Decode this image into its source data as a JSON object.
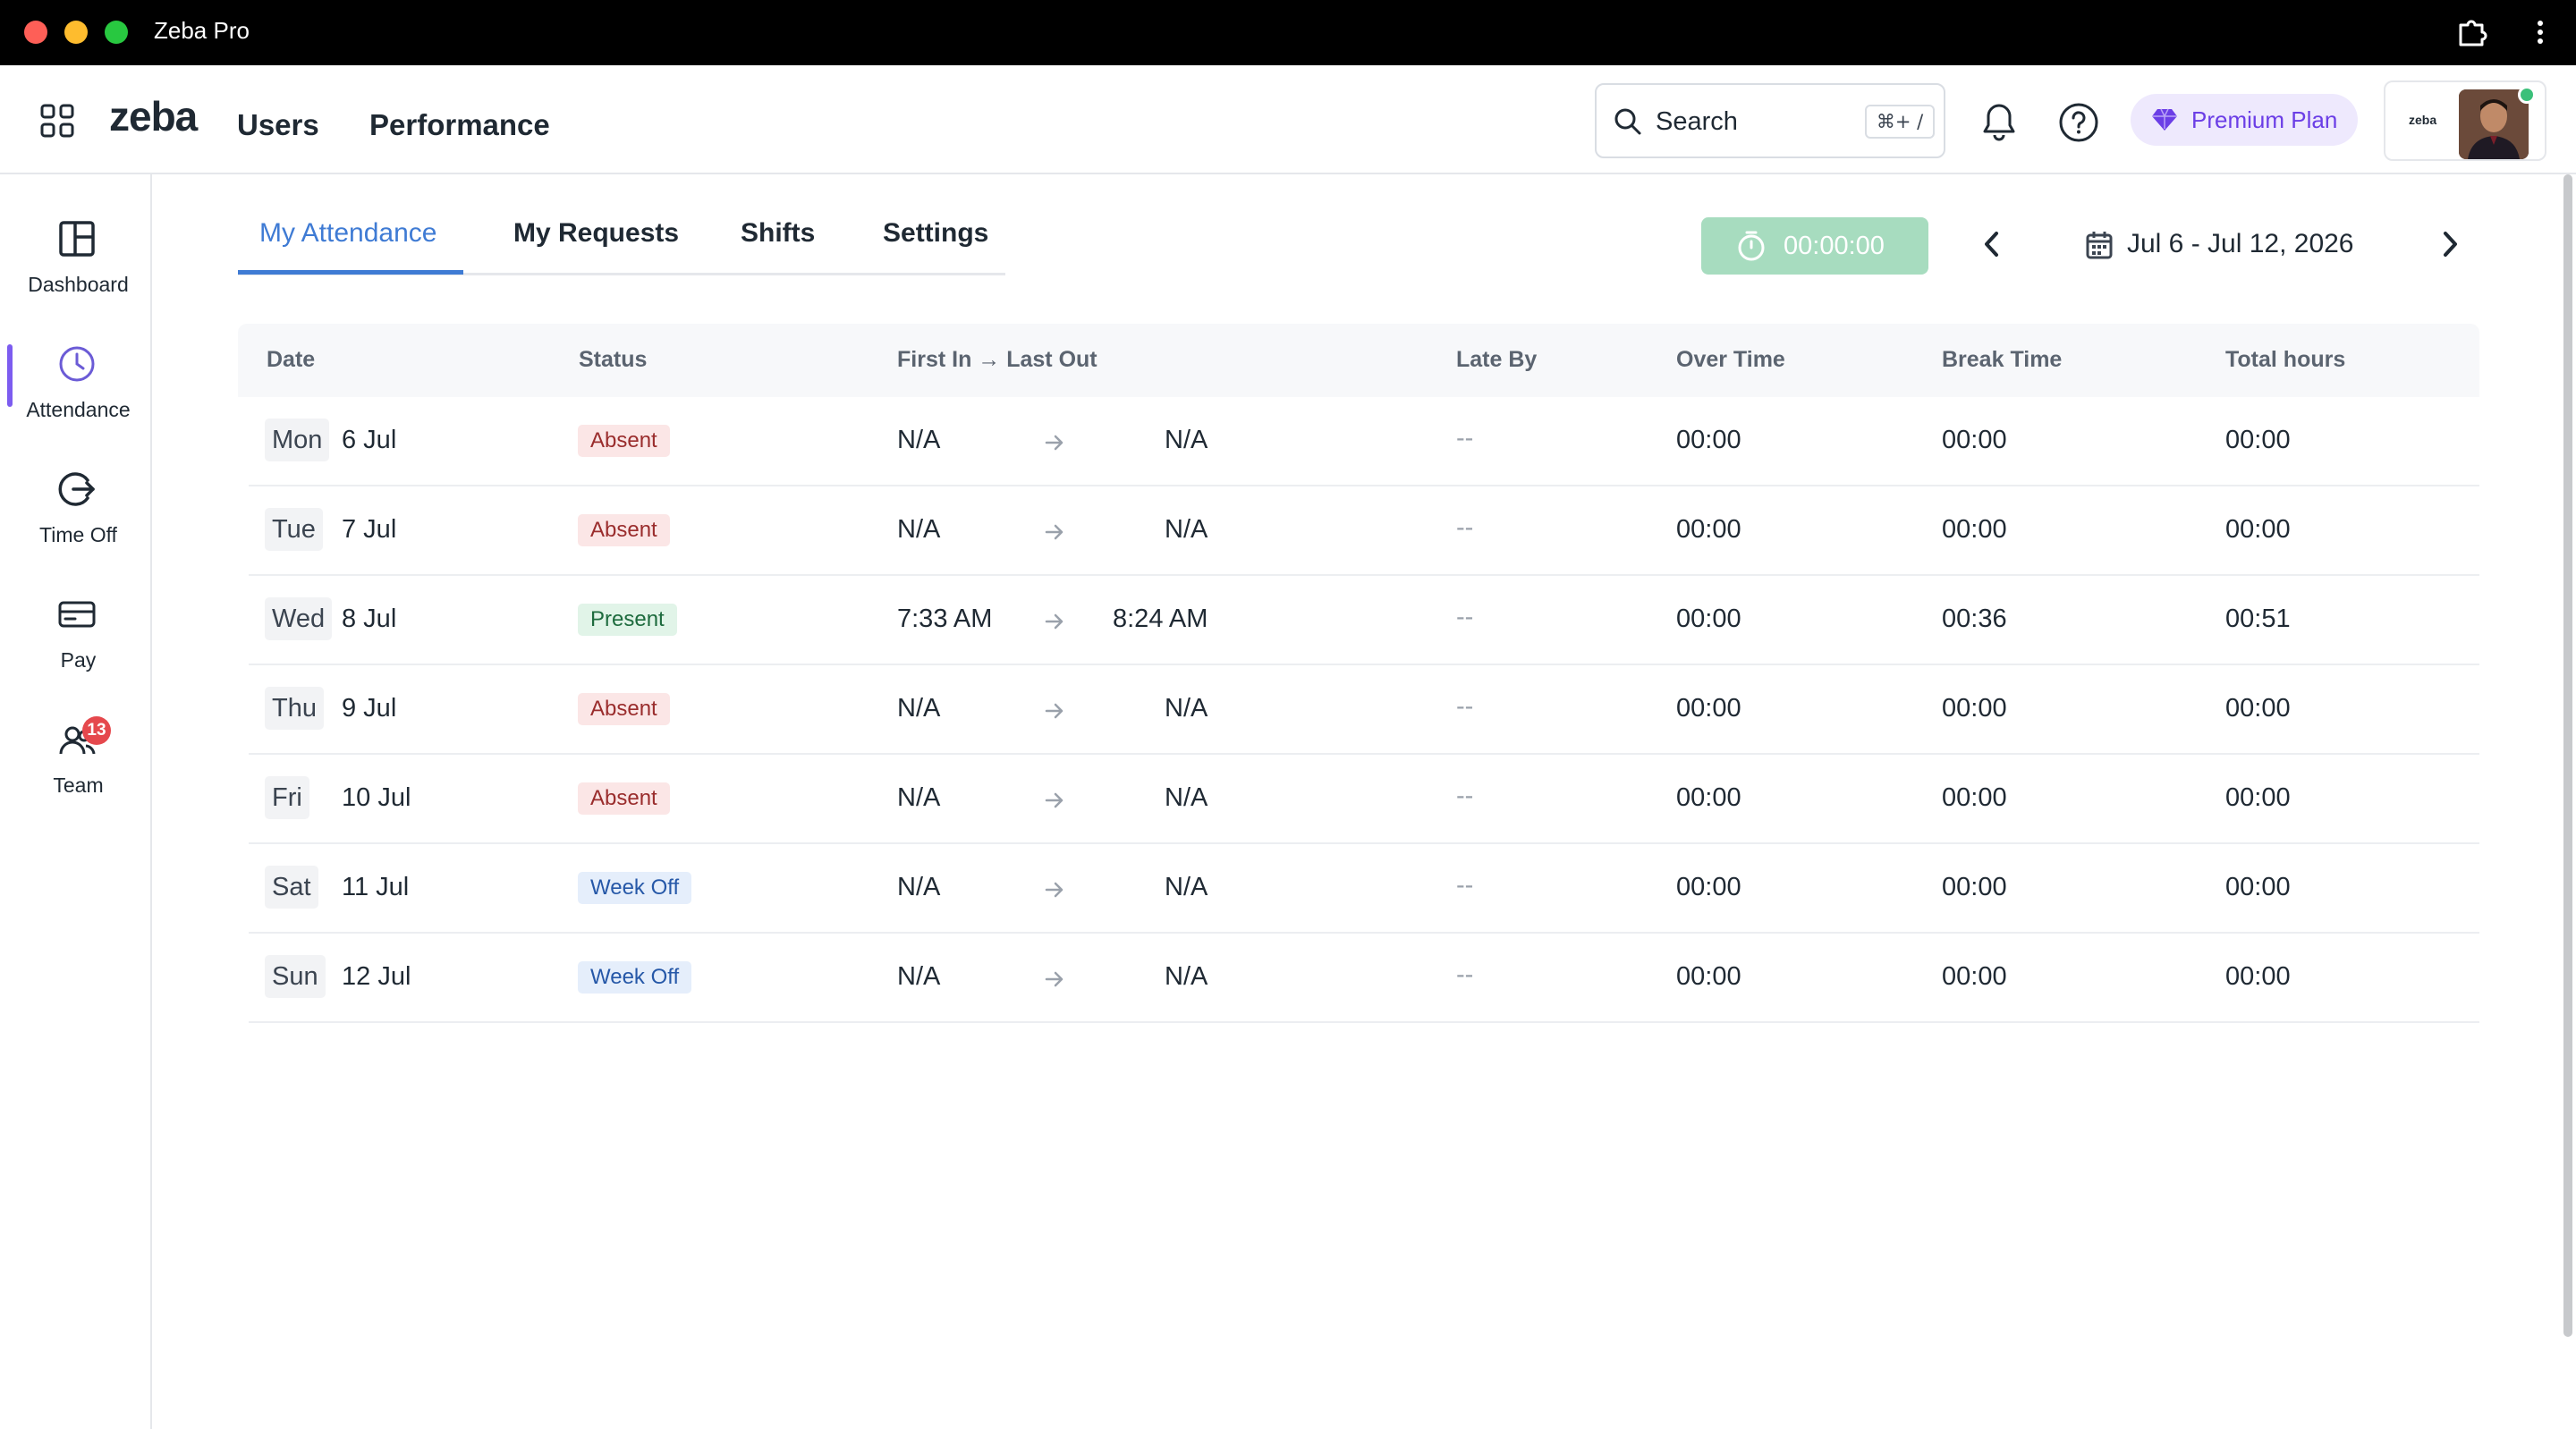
{
  "window": {
    "title": "Zeba Pro"
  },
  "header": {
    "logo": "zeba",
    "nav": {
      "users": "Users",
      "performance": "Performance"
    },
    "search": {
      "placeholder": "Search",
      "shortcut": "⌘+ /"
    },
    "premium_label": "Premium Plan",
    "profile_logo": "zeba"
  },
  "sidebar": {
    "items": [
      {
        "label": "Dashboard",
        "icon": "dashboard-icon"
      },
      {
        "label": "Attendance",
        "icon": "clock-icon",
        "active": true
      },
      {
        "label": "Time Off",
        "icon": "logout-icon"
      },
      {
        "label": "Pay",
        "icon": "card-icon"
      },
      {
        "label": "Team",
        "icon": "team-icon",
        "badge": "13"
      }
    ]
  },
  "tabs": [
    {
      "label": "My Attendance",
      "active": true
    },
    {
      "label": "My Requests"
    },
    {
      "label": "Shifts"
    },
    {
      "label": "Settings"
    }
  ],
  "timer": {
    "value": "00:00:00"
  },
  "date_range": {
    "label": "Jul 6 - Jul 12, 2026"
  },
  "table": {
    "columns": [
      "Date",
      "Status",
      "First In → Last Out",
      "Late By",
      "Over Time",
      "Break Time",
      "Total hours"
    ],
    "rows": [
      {
        "day": "Mon",
        "date": "6 Jul",
        "status": "Absent",
        "status_type": "absent",
        "first_in": "N/A",
        "last_out": "N/A",
        "late_by": "--",
        "over_time": "00:00",
        "break_time": "00:00",
        "total": "00:00"
      },
      {
        "day": "Tue",
        "date": "7 Jul",
        "status": "Absent",
        "status_type": "absent",
        "first_in": "N/A",
        "last_out": "N/A",
        "late_by": "--",
        "over_time": "00:00",
        "break_time": "00:00",
        "total": "00:00"
      },
      {
        "day": "Wed",
        "date": "8 Jul",
        "status": "Present",
        "status_type": "present",
        "first_in": "7:33 AM",
        "last_out": "8:24 AM",
        "late_by": "--",
        "over_time": "00:00",
        "break_time": "00:36",
        "total": "00:51"
      },
      {
        "day": "Thu",
        "date": "9 Jul",
        "status": "Absent",
        "status_type": "absent",
        "first_in": "N/A",
        "last_out": "N/A",
        "late_by": "--",
        "over_time": "00:00",
        "break_time": "00:00",
        "total": "00:00"
      },
      {
        "day": "Fri",
        "date": "10 Jul",
        "status": "Absent",
        "status_type": "absent",
        "first_in": "N/A",
        "last_out": "N/A",
        "late_by": "--",
        "over_time": "00:00",
        "break_time": "00:00",
        "total": "00:00"
      },
      {
        "day": "Sat",
        "date": "11 Jul",
        "status": "Week Off",
        "status_type": "weekoff",
        "first_in": "N/A",
        "last_out": "N/A",
        "late_by": "--",
        "over_time": "00:00",
        "break_time": "00:00",
        "total": "00:00"
      },
      {
        "day": "Sun",
        "date": "12 Jul",
        "status": "Week Off",
        "status_type": "weekoff",
        "first_in": "N/A",
        "last_out": "N/A",
        "late_by": "--",
        "over_time": "00:00",
        "break_time": "00:00",
        "total": "00:00"
      }
    ]
  },
  "colors": {
    "accent": "#3f7bd4",
    "premium": "#6b3ee6",
    "timer": "#a7dcbf",
    "absent_bg": "#fbe6e6",
    "present_bg": "#e1f4e8",
    "weekoff_bg": "#e5eefb"
  }
}
